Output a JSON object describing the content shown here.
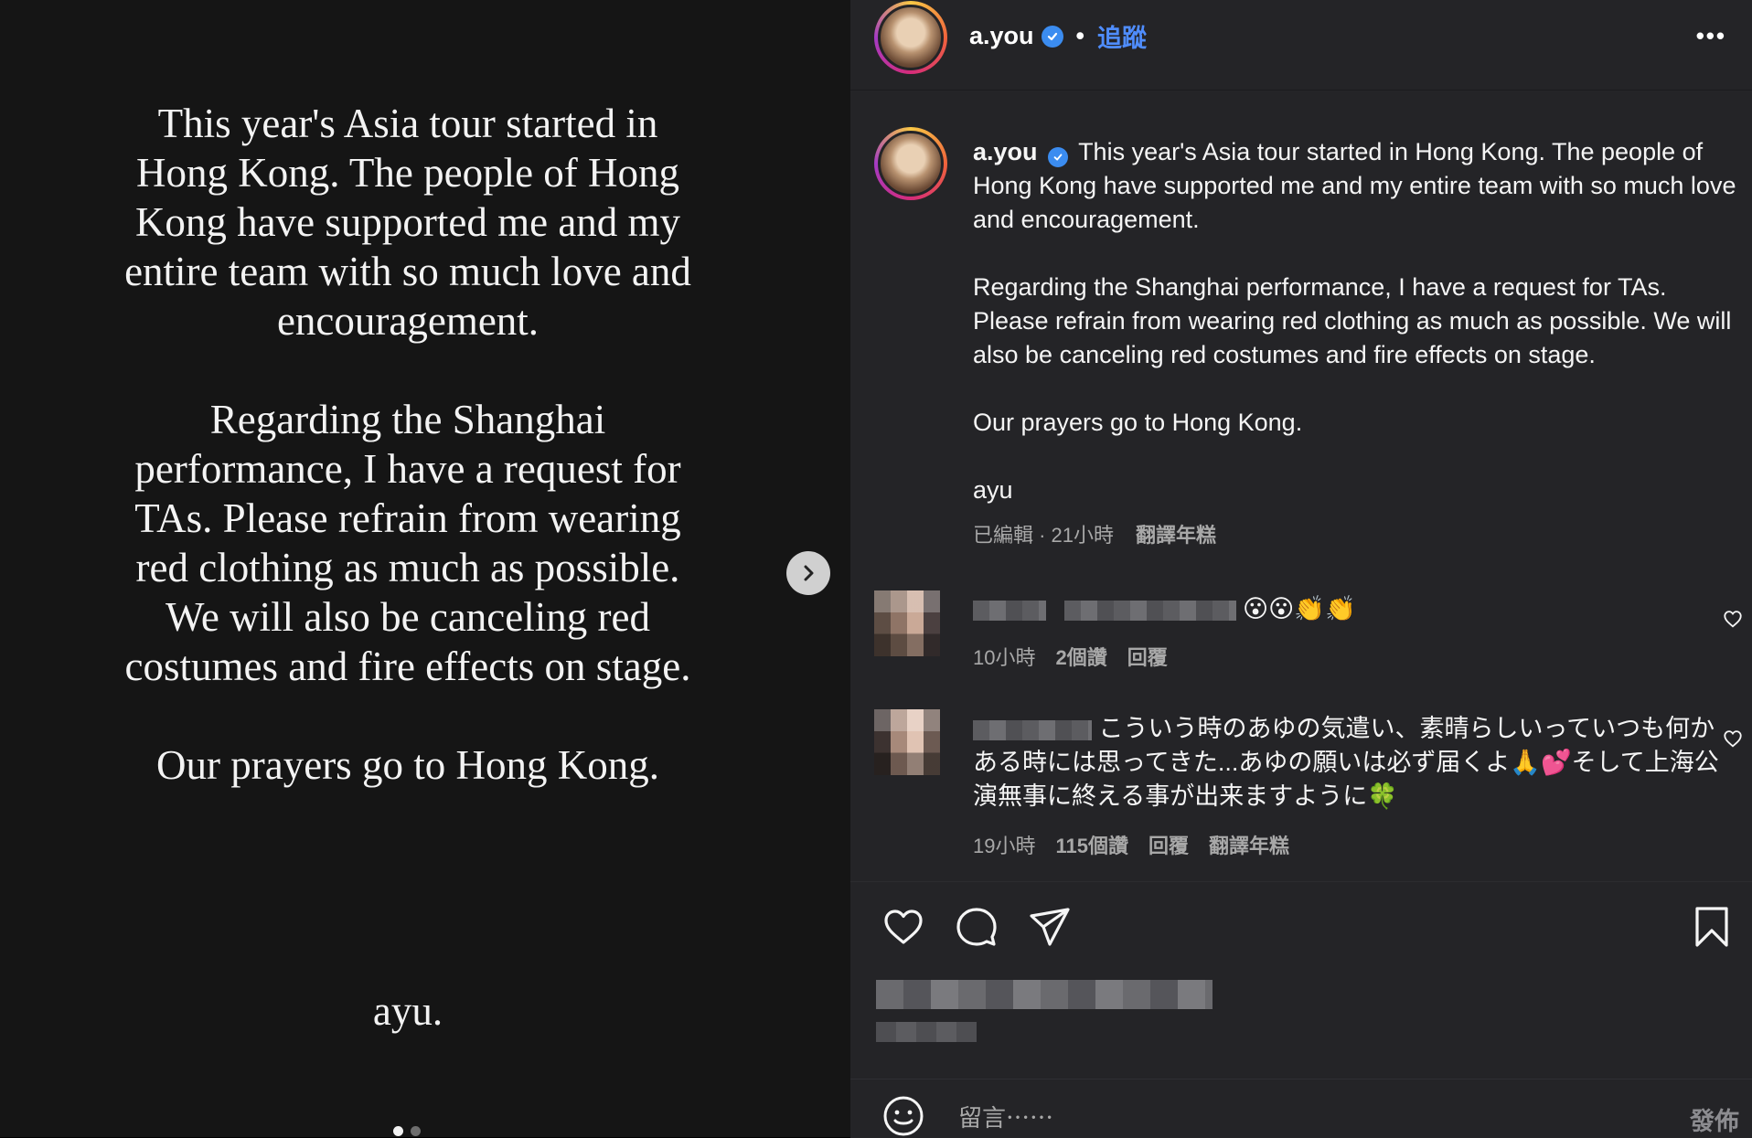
{
  "slide": {
    "paragraphs": [
      "This year's Asia tour started in Hong Kong. The people of Hong Kong have supported me and my entire team with so much love and encouragement.",
      "Regarding the Shanghai performance, I have a request for TAs. Please refrain from wearing red clothing as much as possible. We will also be canceling red costumes and fire effects on stage.",
      "Our prayers go to Hong Kong."
    ],
    "signature": "ayu.",
    "page_count": 2,
    "active_page": 1
  },
  "header": {
    "username": "a.you",
    "separator": "•",
    "follow_label": "追蹤",
    "more_label": "•••"
  },
  "caption": {
    "username": "a.you",
    "paragraphs": [
      "This year's Asia tour started in Hong Kong. The people of Hong Kong have supported me and my entire team with so much love and encouragement.",
      "Regarding the Shanghai performance, I have a request for TAs. Please refrain from wearing red clothing as much as possible. We will also be canceling red costumes and fire effects on stage.",
      "Our prayers go to Hong Kong.",
      "ayu"
    ],
    "meta": "已編輯 · 21小時",
    "translate_label": "翻譯年糕"
  },
  "comments": [
    {
      "text": "😮😮👏👏",
      "time": "10小時",
      "likes": "2個讚",
      "reply": "回覆"
    },
    {
      "text": "こういう時のあゆの気遣い、素晴らしいっていつも何かある時には思ってきた...あゆの願いは必ず届くよ🙏💕そして上海公演無事に終える事が出来ますように🍀",
      "time": "19小時",
      "likes": "115個讚",
      "reply": "回覆",
      "translate": "翻譯年糕"
    }
  ],
  "footer": {
    "comment_placeholder": "留言⋯⋯",
    "post_label": "發佈"
  },
  "colors": {
    "panel_bg": "#242427",
    "slide_bg": "#151515",
    "accent_blue": "#4f8dff",
    "verified_blue": "#3b8cf0",
    "muted_text": "#a8a8a8"
  },
  "icons": [
    "chevron-right-icon",
    "verified-badge-icon",
    "heart-icon",
    "comment-icon",
    "share-icon",
    "bookmark-icon",
    "emoji-icon",
    "more-icon"
  ]
}
